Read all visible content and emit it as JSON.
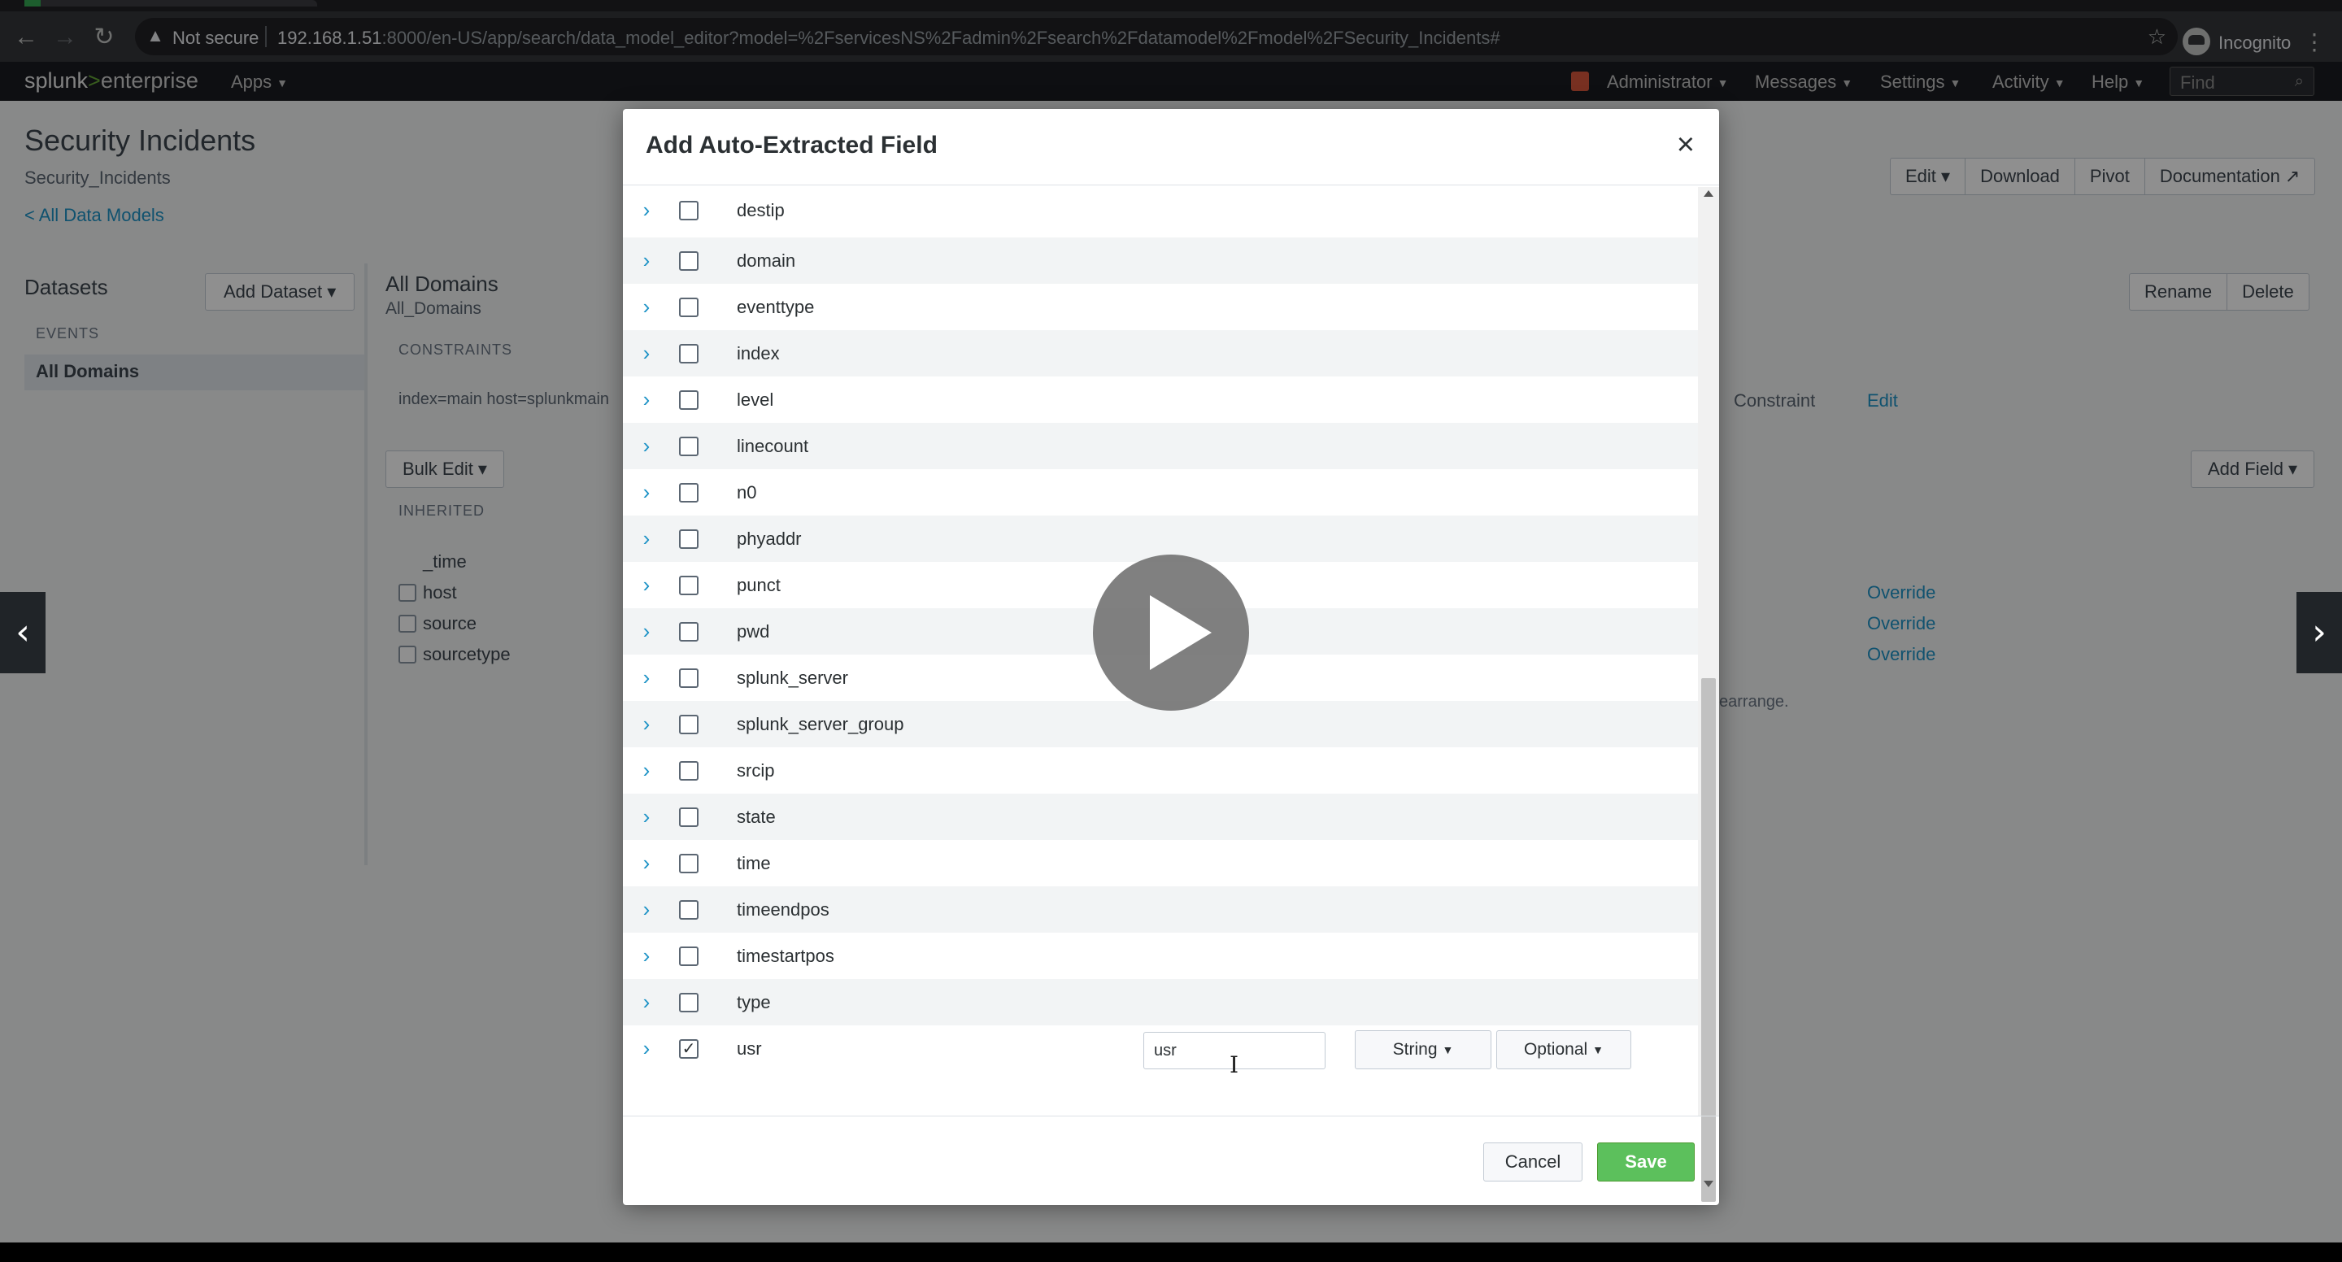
{
  "browser": {
    "not_secure": "Not secure",
    "url_host": "192.168.1.51",
    "url_rest": ":8000/en-US/app/search/data_model_editor?model=%2FservicesNS%2Fadmin%2Fsearch%2Fdatamodel%2Fmodel%2FSecurity_Incidents#",
    "profile": "Incognito",
    "icons": [
      "back-icon",
      "forward-icon",
      "reload-icon",
      "warning-icon",
      "star-icon",
      "incognito-icon",
      "menu-icon"
    ]
  },
  "splunk": {
    "logo_part1": "splunk",
    "logo_part2": ">",
    "logo_part3": "enterprise",
    "menu": {
      "apps": "Apps",
      "administrator": "Administrator",
      "messages": "Messages",
      "settings": "Settings",
      "activity": "Activity",
      "help": "Help",
      "find": "Find"
    }
  },
  "page": {
    "title": "Security Incidents",
    "subtitle": "Security_Incidents",
    "back_link": "< All Data Models",
    "header_buttons": [
      "Edit ▾",
      "Download",
      "Pivot",
      "Documentation ↗"
    ],
    "datasets_label": "Datasets",
    "add_dataset": "Add Dataset ▾",
    "events_label": "EVENTS",
    "dataset_item": "All Domains",
    "main_title": "All Domains",
    "main_subtitle": "All_Domains",
    "action_buttons": [
      "Rename",
      "Delete"
    ],
    "constraints_label": "CONSTRAINTS",
    "constraint_value": "index=main host=splunkmain",
    "constraint_col": "Constraint",
    "edit_col": "Edit",
    "bulk_edit": "Bulk Edit ▾",
    "add_field": "Add Field ▾",
    "inherited_label": "INHERITED",
    "inherited_fields": [
      "_time",
      "host",
      "source",
      "sourcetype"
    ],
    "override_label": "Override",
    "rearrange_hint": "earrange."
  },
  "modal": {
    "title": "Add Auto-Extracted Field",
    "close": "×",
    "fields": [
      {
        "name": "destip",
        "checked": false
      },
      {
        "name": "domain",
        "checked": false
      },
      {
        "name": "eventtype",
        "checked": false
      },
      {
        "name": "index",
        "checked": false
      },
      {
        "name": "level",
        "checked": false
      },
      {
        "name": "linecount",
        "checked": false
      },
      {
        "name": "n0",
        "checked": false
      },
      {
        "name": "phyaddr",
        "checked": false
      },
      {
        "name": "punct",
        "checked": false
      },
      {
        "name": "pwd",
        "checked": false
      },
      {
        "name": "splunk_server",
        "checked": false
      },
      {
        "name": "splunk_server_group",
        "checked": false
      },
      {
        "name": "srcip",
        "checked": false
      },
      {
        "name": "state",
        "checked": false
      },
      {
        "name": "time",
        "checked": false
      },
      {
        "name": "timeendpos",
        "checked": false
      },
      {
        "name": "timestartpos",
        "checked": false
      },
      {
        "name": "type",
        "checked": false
      },
      {
        "name": "usr",
        "checked": true
      }
    ],
    "selected_field": {
      "display_name": "usr",
      "type": "String",
      "flag": "Optional"
    },
    "cancel": "Cancel",
    "save": "Save"
  },
  "player": {
    "prev": "‹",
    "next": "›"
  },
  "colors": {
    "accent": "#1e93c6",
    "save_green": "#5cc05c",
    "brand_green": "#65a637",
    "app_bar": "#1a1c20"
  }
}
